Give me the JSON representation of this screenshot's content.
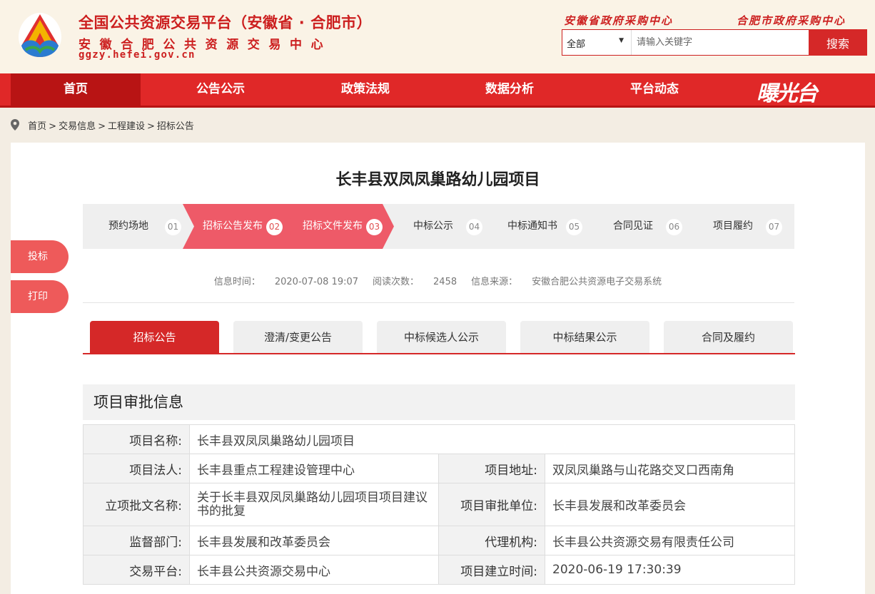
{
  "header": {
    "title": "全国公共资源交易平台（安徽省 · 合肥市）",
    "subtitle": "安徽合肥公共资源交易中心",
    "domain": "ggzy.hefei.gov.cn",
    "links": [
      "安徽省政府采购中心",
      "合肥市政府采购中心"
    ]
  },
  "search": {
    "select_value": "全部",
    "placeholder": "请输入关键字",
    "button_label": "搜索"
  },
  "nav": {
    "items": [
      "首页",
      "公告公示",
      "政策法规",
      "数据分析",
      "平台动态"
    ],
    "brand": "曝光台"
  },
  "breadcrumb": [
    "首页",
    "交易信息",
    "工程建设",
    "招标公告"
  ],
  "side_buttons": [
    "投标",
    "打印"
  ],
  "project": {
    "title": "长丰县双凤凤巢路幼儿园项目"
  },
  "steps": [
    {
      "label": "预约场地",
      "num": "01",
      "active": false
    },
    {
      "label": "招标公告发布",
      "num": "02",
      "active": true
    },
    {
      "label": "招标文件发布",
      "num": "03",
      "active": true
    },
    {
      "label": "中标公示",
      "num": "04",
      "active": false
    },
    {
      "label": "中标通知书",
      "num": "05",
      "active": false
    },
    {
      "label": "合同见证",
      "num": "06",
      "active": false
    },
    {
      "label": "项目履约",
      "num": "07",
      "active": false
    }
  ],
  "info": {
    "time_label": "信息时间：",
    "time_value": "2020-07-08 19:07",
    "views_label": "阅读次数：",
    "views_value": "2458",
    "source_label": "信息来源：",
    "source_value": "安徽合肥公共资源电子交易系统"
  },
  "tabs": [
    "招标公告",
    "澄清/变更公告",
    "中标候选人公示",
    "中标结果公示",
    "合同及履约"
  ],
  "section": {
    "title": "项目审批信息"
  },
  "table": {
    "name_label": "项目名称:",
    "name_value": "长丰县双凤凤巢路幼儿园项目",
    "rows": [
      {
        "k1": "项目法人:",
        "v1": "长丰县重点工程建设管理中心",
        "k2": "项目地址:",
        "v2": "双凤凤巢路与山花路交叉口西南角"
      },
      {
        "k1": "立项批文名称:",
        "v1": "关于长丰县双凤凤巢路幼儿园项目项目建议书的批复",
        "k2": "项目审批单位:",
        "v2": "长丰县发展和改革委员会"
      },
      {
        "k1": "监督部门:",
        "v1": "长丰县发展和改革委员会",
        "k2": "代理机构:",
        "v2": "长丰县公共资源交易有限责任公司"
      },
      {
        "k1": "交易平台:",
        "v1": "长丰县公共资源交易中心",
        "k2": "项目建立时间:",
        "v2": "2020-06-19 17:30:39"
      }
    ]
  },
  "colors": {
    "primary_red": "#e02828",
    "dark_red": "#b81414",
    "step_active": "#ee5a68",
    "step_inactive": "#efefef"
  }
}
